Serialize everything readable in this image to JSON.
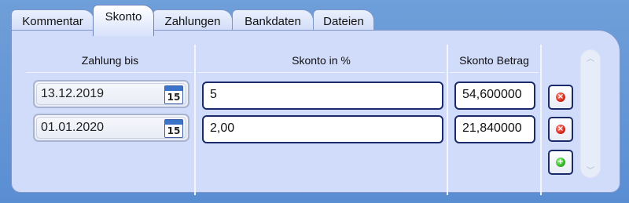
{
  "tabs": [
    {
      "label": "Kommentar"
    },
    {
      "label": "Skonto"
    },
    {
      "label": "Zahlungen"
    },
    {
      "label": "Bankdaten"
    },
    {
      "label": "Dateien"
    }
  ],
  "active_tab": "Skonto",
  "columns": {
    "date": "Zahlung bis",
    "percent": "Skonto in %",
    "amount": "Skonto Betrag"
  },
  "rows": [
    {
      "date": "13.12.2019",
      "percent": "5",
      "amount": "54,600000"
    },
    {
      "date": "01.01.2020",
      "percent": "2,00",
      "amount": "21,840000"
    }
  ],
  "calendar_icon_day": "15",
  "icons": {
    "delete": "delete-icon",
    "add": "add-icon",
    "calendar": "calendar-icon"
  },
  "colors": {
    "background": "#5a8ed3",
    "panel": "#d1dbfa",
    "field_border": "#1a2a6a",
    "delete": "#d62a1e",
    "add": "#36b52c"
  }
}
